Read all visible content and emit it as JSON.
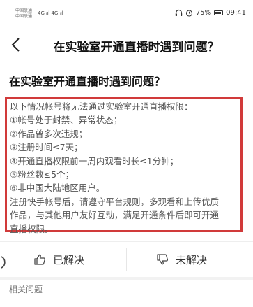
{
  "status_bar": {
    "carrier_1": "中国联通",
    "carrier_2": "中国联通",
    "network": "4G ᵢıl 4G ᵢıl",
    "battery": "75%",
    "time": "09:41",
    "icons": [
      "headphone-icon",
      "alarm-icon",
      "battery-icon"
    ]
  },
  "nav": {
    "title": "在实验室开通直播时遇到问题？",
    "back_icon": "chevron-left-icon"
  },
  "article": {
    "heading": "在实验室开通直播时遇到问题？",
    "lines": [
      "以下情况帐号将无法通过实验室开通直播权限：",
      "①帐号处于封禁、异常状态；",
      "②作品曾多次违规；",
      "③注册时间≤7天；",
      "④开通直播权限前一周内观看时长≤1分钟；",
      "⑤粉丝数≤5个；",
      "⑥非中国大陆地区用户。",
      "注册快手帐号后，请遵守平台规则，多观看和上传优质",
      "作品，与其他用户友好互动，满足开通条件后即可开通",
      "直播权限。"
    ],
    "highlight_color": "#d13a3a"
  },
  "feedback": {
    "solved_label": "已解决",
    "unsolved_label": "未解决"
  },
  "related": {
    "label": "相关问题"
  }
}
